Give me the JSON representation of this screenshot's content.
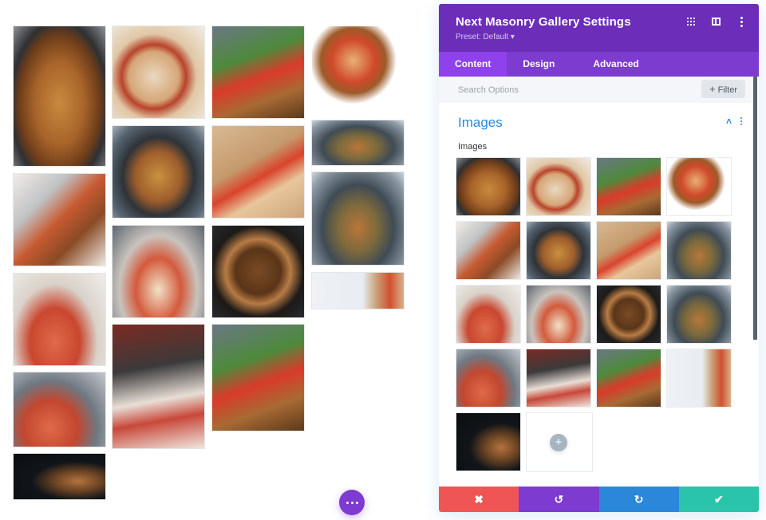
{
  "panel": {
    "title": "Next Masonry Gallery Settings",
    "preset": "Preset: Default ▾",
    "header_icons": [
      "expand-icon",
      "split-view-icon",
      "more-options-icon"
    ],
    "tabs": [
      {
        "label": "Content",
        "active": true
      },
      {
        "label": "Design",
        "active": false
      },
      {
        "label": "Advanced",
        "active": false
      }
    ],
    "search": {
      "placeholder": "Search Options",
      "value": ""
    },
    "filter": {
      "label": "Filter",
      "icon": "+"
    },
    "section": {
      "title": "Images",
      "toggle_icon": "˄",
      "field_label": "Images"
    },
    "thumbnails": [
      {
        "subject": "pizza on dark pan with oven mitt",
        "style": "p-pizza-dark"
      },
      {
        "subject": "pizza being cut with wheel cutter",
        "style": "p-pizza-cut"
      },
      {
        "subject": "tomato and basil on cutting board",
        "style": "p-tomato-basil"
      },
      {
        "subject": "pizza on wooden board",
        "style": "p-board"
      },
      {
        "subject": "pizza with rocker cutter",
        "style": "p-cutter"
      },
      {
        "subject": "pizza on round pan",
        "style": "p-pan"
      },
      {
        "subject": "pizza slice on paper",
        "style": "p-slice"
      },
      {
        "subject": "basil pizza on pan",
        "style": "p-basil-pan"
      },
      {
        "subject": "sauce pizza with cheese cubes",
        "style": "p-sauce"
      },
      {
        "subject": "hand adding cheese to pizza",
        "style": "p-cheese"
      },
      {
        "subject": "pizza cut on wooden board",
        "style": "p-wood-dark"
      },
      {
        "subject": "basil pizza on pan close",
        "style": "p-basil-pan"
      },
      {
        "subject": "adding cheese to sauce pizza",
        "style": "p-sauce2"
      },
      {
        "subject": "raw dough with cheese",
        "style": "p-dough"
      },
      {
        "subject": "slicing tomato",
        "style": "p-tomato-basil"
      },
      {
        "subject": "pizza slice on white",
        "style": "p-slice-white"
      },
      {
        "subject": "top view dark table pizza",
        "style": "p-dark-top"
      }
    ],
    "add_image_icon": "+",
    "footer": {
      "cancel_icon": "✖",
      "undo_icon": "↺",
      "redo_icon": "↻",
      "save_icon": "✔"
    }
  },
  "gallery": {
    "images": [
      {
        "subject": "pizza on dark pan with oven mitt",
        "style": "p-pizza-dark"
      },
      {
        "subject": "pizza with rocker cutter",
        "style": "p-cutter"
      },
      {
        "subject": "sauce pizza with cheese cubes",
        "style": "p-sauce"
      },
      {
        "subject": "adding cheese to sauce pizza",
        "style": "p-sauce2"
      },
      {
        "subject": "top view dark table pizza",
        "style": "p-dark-top"
      },
      {
        "subject": "pizza being cut with wheel cutter",
        "style": "p-pizza-cut"
      },
      {
        "subject": "pizza on round pan",
        "style": "p-pan"
      },
      {
        "subject": "hand adding cheese to pizza",
        "style": "p-cheese"
      },
      {
        "subject": "raw dough with cheese",
        "style": "p-dough"
      },
      {
        "subject": "tomato and basil on cutting board",
        "style": "p-tomato-basil"
      },
      {
        "subject": "pizza slice on paper",
        "style": "p-slice"
      },
      {
        "subject": "pizza cut on wooden board",
        "style": "p-wood-dark"
      },
      {
        "subject": "slicing tomato",
        "style": "p-tomato-basil"
      },
      {
        "subject": "pizza on wooden board",
        "style": "p-board"
      },
      {
        "subject": "basil pizza on pan",
        "style": "p-basil-pan"
      },
      {
        "subject": "basil pizza on pan close",
        "style": "p-basil-pan"
      },
      {
        "subject": "pizza slice on white",
        "style": "p-slice-white"
      }
    ]
  },
  "fab": {
    "icon": "more-horizontal-icon"
  },
  "colors": {
    "header": "#6c2eb9",
    "tabs": "#7d3bcf",
    "active_tab": "#8f42ec",
    "accent_blue": "#2b87da",
    "cancel": "#ef5555",
    "undo": "#7e3bd0",
    "redo": "#2b87da",
    "save": "#29c4a9"
  }
}
